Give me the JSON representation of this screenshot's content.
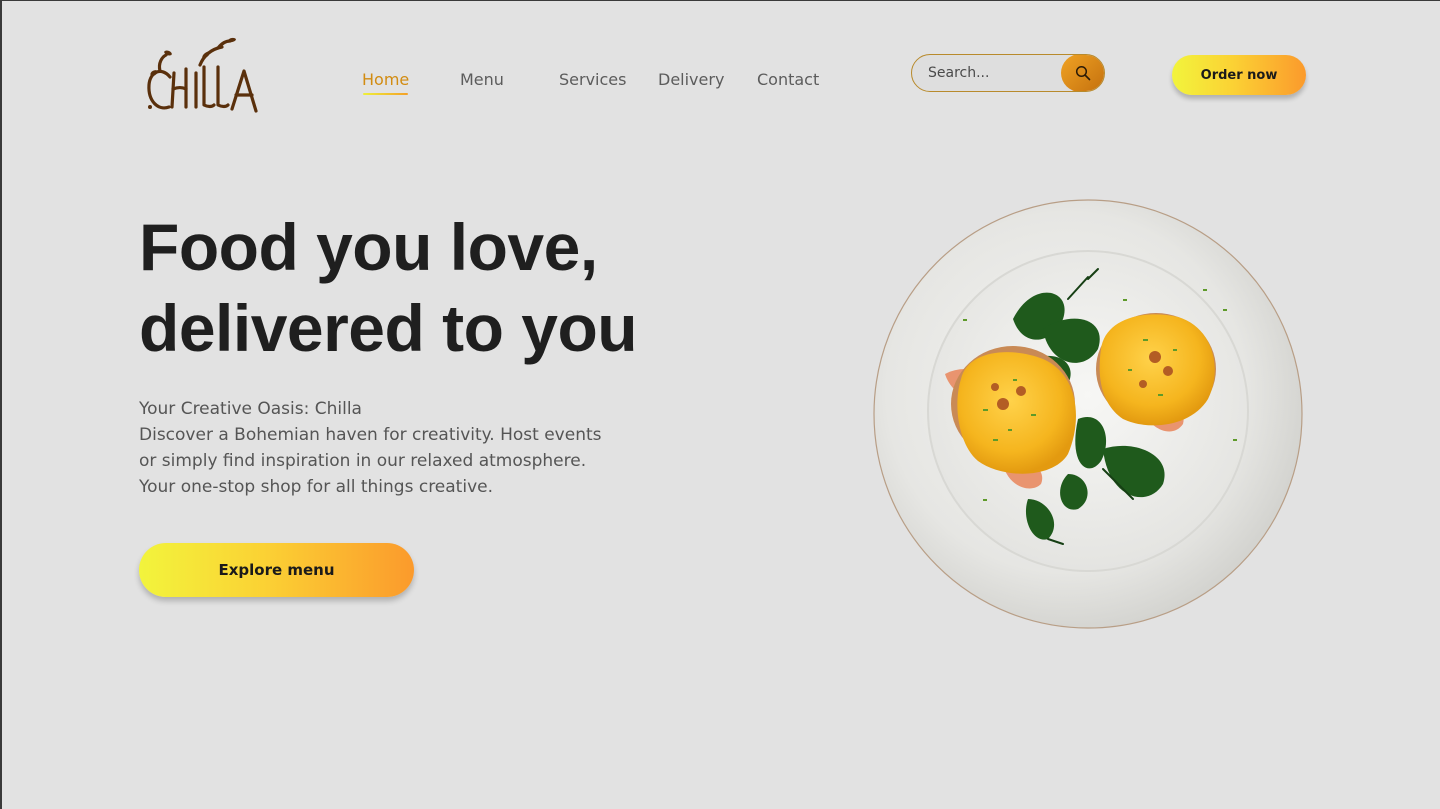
{
  "brand": {
    "logo_text": "CHILLA"
  },
  "nav": {
    "items": [
      {
        "label": "Home",
        "active": true
      },
      {
        "label": "Menu",
        "active": false
      },
      {
        "label": "Services",
        "active": false
      },
      {
        "label": "Delivery",
        "active": false
      },
      {
        "label": "Contact",
        "active": false
      }
    ]
  },
  "search": {
    "placeholder": "Search...",
    "icon": "search-icon"
  },
  "header": {
    "order_label": "Order now"
  },
  "hero": {
    "title_line1": "Food you love,",
    "title_line2": "delivered to you",
    "text_lines": [
      "Your Creative Oasis: Chilla",
      "Discover a Bohemian haven for creativity. Host events",
      "or simply find inspiration in our relaxed atmosphere.",
      "Your one-stop shop for all things creative."
    ],
    "cta_label": "Explore menu"
  },
  "colors": {
    "background": "#e2e2e2",
    "accent_start": "#f2f43c",
    "accent_end": "#fb9a2c",
    "nav_active": "#d28c12",
    "heading": "#1f1f1f",
    "logo": "#5a300c"
  },
  "image": {
    "subject": "eggs-benedict-plate"
  }
}
